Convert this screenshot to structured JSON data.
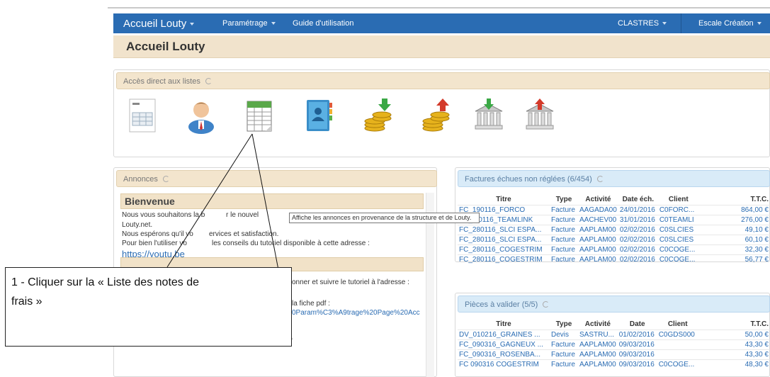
{
  "navbar": {
    "brand": "Accueil Louty",
    "menu": [
      "Paramétrage",
      "Guide d'utilisation"
    ],
    "user": "CLASTRES",
    "company": "Escale Création"
  },
  "page_title": "Accueil Louty",
  "direct_access": {
    "title": "Accès direct aux listes",
    "icons": [
      "invoice-document-icon",
      "user-person-icon",
      "expense-notes-list-icon",
      "address-book-icon",
      "coins-down-icon",
      "coins-up-icon",
      "bank-in-icon",
      "bank-out-icon"
    ]
  },
  "announcements": {
    "title": "Annonces",
    "welcome_title": "Bienvenue",
    "lines": [
      "Nous vous souhaitons la b",
      "r le nouvel",
      "Louty.net.",
      "Nous espérons qu'il vo",
      "ervices et satisfaction.",
      "Pour bien l'utiliser vo",
      "les conseils du tutoriel disponible à cette adresse :"
    ],
    "link": "https://youtu.be",
    "para2": "onner et suivre le tutoriel à l'adresse :",
    "para3": "la fiche pdf :",
    "link2": "0Param%C3%A9trage%20Page%20Acc"
  },
  "tooltip": "Affiche les annonces en provenance de la structure et de Louty.",
  "unpaid": {
    "title": "Factures échues non réglées (6/454)",
    "columns": [
      "Titre",
      "Type",
      "Activité",
      "Date éch.",
      "Client",
      "T.T.C."
    ],
    "rows": [
      [
        "FC_190116_FORCO",
        "Facture",
        "AAGADA00",
        "24/01/2016",
        "C0FORC...",
        "864,00 €"
      ],
      [
        "FC_1 0116_TEAMLINK",
        "Facture",
        "AACHEV00",
        "31/01/2016",
        "C0TEAMLI",
        "276,00 €"
      ],
      [
        "FC_280116_SLCI ESPA...",
        "Facture",
        "AAPLAM00",
        "02/02/2016",
        "C0SLCIES",
        "49,10 €"
      ],
      [
        "FC_280116_SLCI ESPA...",
        "Facture",
        "AAPLAM00",
        "02/02/2016",
        "C0SLCIES",
        "60,10 €"
      ],
      [
        "FC_280116_COGESTRIM",
        "Facture",
        "AAPLAM00",
        "02/02/2016",
        "C0COGE...",
        "32,30 €"
      ],
      [
        "FC_280116_COGESTRIM",
        "Facture",
        "AAPLAM00",
        "02/02/2016",
        "C0COGE...",
        "56,77 €"
      ]
    ]
  },
  "to_validate": {
    "title": "Pièces à valider (5/5)",
    "columns": [
      "Titre",
      "Type",
      "Activité",
      "Date",
      "Client",
      "T.T.C."
    ],
    "rows": [
      [
        "DV_010216_GRAINES ...",
        "Devis",
        "SASTRU...",
        "01/02/2016",
        "C0GDS000",
        "50,00 €"
      ],
      [
        "FC_090316_GAGNEUX ...",
        "Facture",
        "AAPLAM00",
        "09/03/2016",
        "",
        "43,30 €"
      ],
      [
        "FC_090316_ROSENBA...",
        "Facture",
        "AAPLAM00",
        "09/03/2016",
        "",
        "43,30 €"
      ],
      [
        "FC 090316 COGESTRIM",
        "Facture",
        "AAPLAM00",
        "09/03/2016",
        "C0COGE...",
        "48,30 €"
      ]
    ]
  },
  "callout": {
    "line1": "1 - Cliquer sur la « Liste des notes de",
    "line2": "frais »"
  },
  "colors": {
    "navbar": "#2a6cb3",
    "title_bg": "#f1e3cc",
    "blue_head": "#d9ebf8",
    "link": "#2a6cb3"
  }
}
